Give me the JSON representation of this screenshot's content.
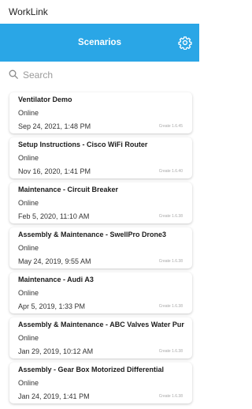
{
  "app": {
    "title": "WorkLink"
  },
  "header": {
    "title": "Scenarios",
    "settings_icon": "gear-icon"
  },
  "search": {
    "placeholder": "Search",
    "value": "",
    "icon": "search-icon"
  },
  "colors": {
    "accent": "#2aa6e6"
  },
  "scenarios": [
    {
      "title": "Ventilator Demo",
      "status": "Online",
      "date": "Sep 24, 2021, 1:48 PM",
      "version": "Create 1.6.45"
    },
    {
      "title": "Setup Instructions - Cisco WiFi Router",
      "status": "Online",
      "date": "Nov 16, 2020, 1:41 PM",
      "version": "Create 1.6.40"
    },
    {
      "title": "Maintenance - Circuit Breaker",
      "status": "Online",
      "date": "Feb 5, 2020, 11:10 AM",
      "version": "Create 1.6.38"
    },
    {
      "title": "Assembly & Maintenance - SwellPro Drone3",
      "status": "Online",
      "date": "May 24, 2019, 9:55 AM",
      "version": "Create 1.6.38"
    },
    {
      "title": "Maintenance - Audi A3",
      "status": "Online",
      "date": "Apr 5, 2019, 1:33 PM",
      "version": "Create 1.6.38"
    },
    {
      "title": "Assembly & Maintenance - ABC Valves Water Pur",
      "status": "Online",
      "date": "Jan 29, 2019, 10:12 AM",
      "version": "Create 1.6.38"
    },
    {
      "title": "Assembly - Gear Box Motorized Differential",
      "status": "Online",
      "date": "Jan 24, 2019, 1:41 PM",
      "version": "Create 1.6.38"
    }
  ]
}
